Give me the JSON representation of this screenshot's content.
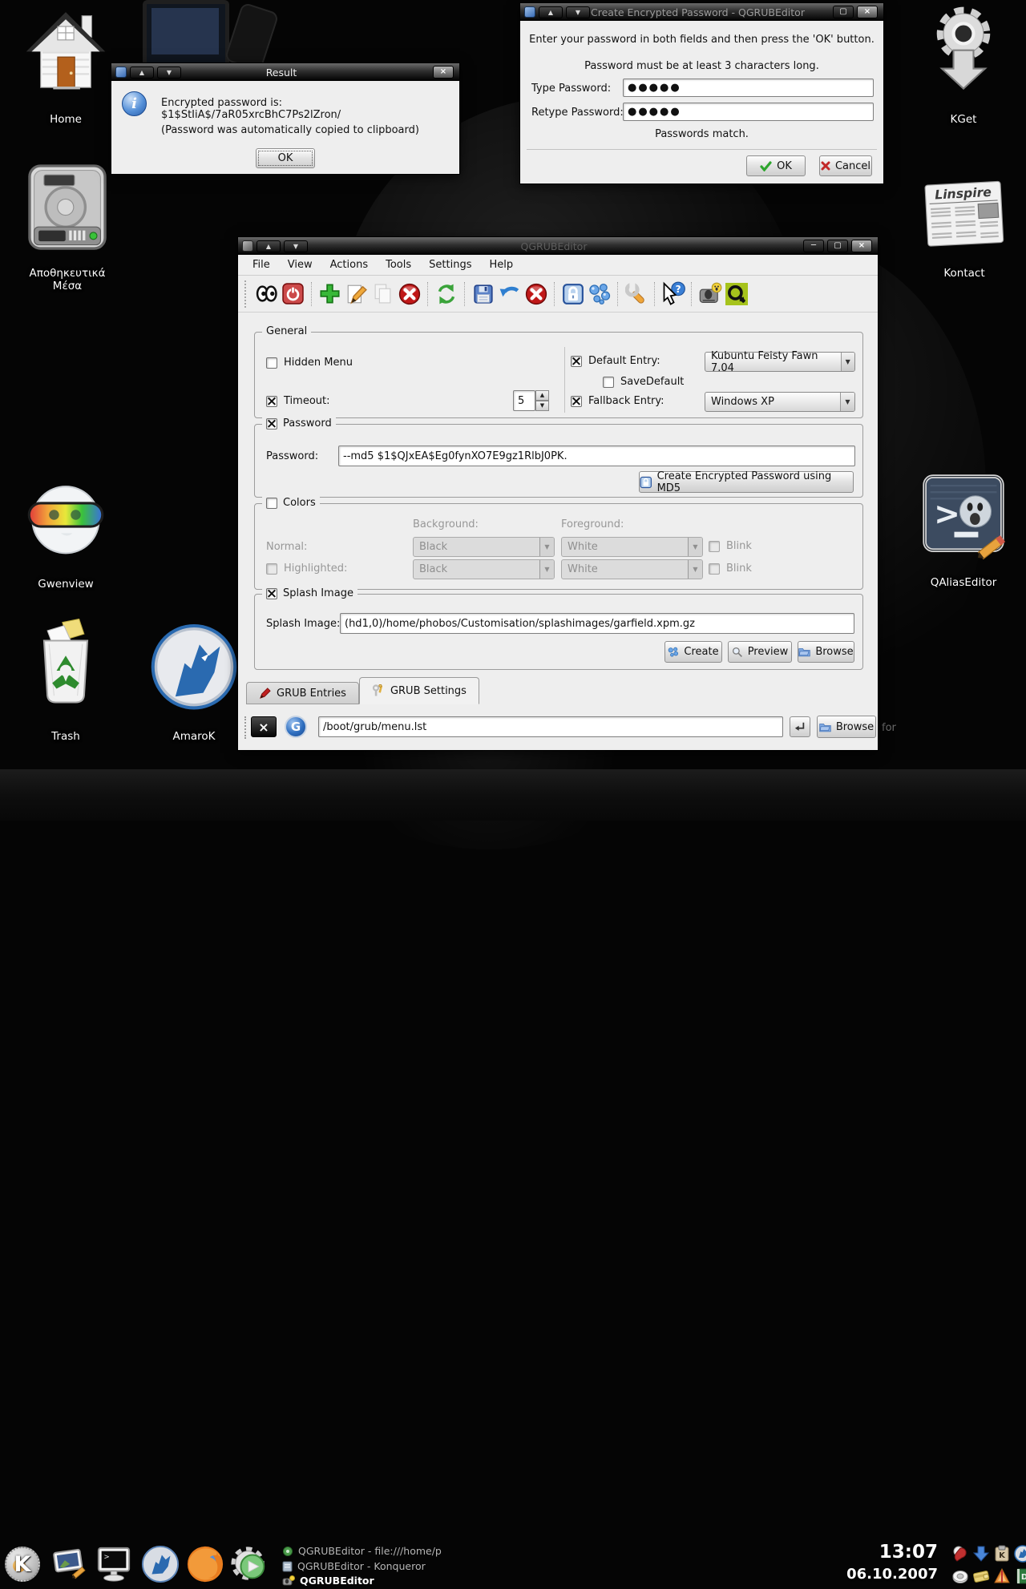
{
  "desktop": {
    "background_color": "#050505",
    "faint_text": "for",
    "icons": [
      {
        "label": "Home",
        "icon": "home-icon"
      },
      {
        "label": "KGet",
        "icon": "gear-download-icon"
      },
      {
        "label": "Αποθηκευτικά Μέσα",
        "icon": "hard-drive-icon"
      },
      {
        "label": "Kontact",
        "icon": "newspaper-icon"
      },
      {
        "label": "Gwenview",
        "icon": "rainbow-goggles-icon"
      },
      {
        "label": "QAliasEditor",
        "icon": "terminal-smiley-icon"
      },
      {
        "label": "Trash",
        "icon": "trash-can-icon"
      },
      {
        "label": "AmaroK",
        "icon": "blue-wolf-icon"
      }
    ]
  },
  "result_dialog": {
    "title": "Result",
    "icon": "info-icon",
    "message_line1": "Encrypted password is: $1$StIiA$/7aR05xrcBhC7Ps2lZron/",
    "message_line2": "(Password was automatically copied to clipboard)",
    "ok_label": "OK"
  },
  "password_dialog": {
    "title": "Create Encrypted Password - QGRUBEditor",
    "instruction": "Enter your password in both fields and then press the 'OK' button.",
    "requirement": "Password must be at least 3 characters long.",
    "type_password_label": "Type Password:",
    "retype_password_label": "Retype Password:",
    "password_value": "●●●●●",
    "retype_value": "●●●●●",
    "status": "Passwords match.",
    "ok_label": "OK",
    "cancel_label": "Cancel"
  },
  "main_window": {
    "title": "QGRUBEditor",
    "menu_items": [
      "File",
      "View",
      "Actions",
      "Tools",
      "Settings",
      "Help"
    ],
    "toolbar_icons": [
      "eyes",
      "shutdown",
      "add-entry",
      "edit-entry",
      "copy-entry",
      "delete-entry",
      "refresh",
      "save",
      "revert",
      "discard",
      "create-encrypted-password",
      "create-splash-image",
      "configure-wrench",
      "whats-this",
      "device-alias",
      "qgrubeditor-logo"
    ],
    "general": {
      "legend": "General",
      "hidden_menu_label": "Hidden Menu",
      "timeout_label": "Timeout:",
      "timeout_value": "5",
      "default_entry_label": "Default Entry:",
      "default_entry_value": "Kubuntu Feisty Fawn 7.04",
      "savedefault_label": "SaveDefault",
      "fallback_entry_label": "Fallback Entry:",
      "fallback_entry_value": "Windows XP"
    },
    "password": {
      "legend": "Password",
      "password_label": "Password:",
      "password_value": "--md5 $1$QJxEA$Eg0fynXO7E9gz1RlbJ0PK.",
      "create_button_label": "Create Encrypted Password using MD5"
    },
    "colors": {
      "legend": "Colors",
      "background_header": "Background:",
      "foreground_header": "Foreground:",
      "normal_label": "Normal:",
      "highlighted_label": "Highlighted:",
      "normal_background": "Black",
      "normal_foreground": "White",
      "highlighted_background": "Black",
      "highlighted_foreground": "White",
      "blink_label_1": "Blink",
      "blink_label_2": "Blink"
    },
    "splash": {
      "legend": "Splash Image",
      "label": "Splash Image:",
      "value": "(hd1,0)/home/phobos/Customisation/splashimages/garfield.xpm.gz",
      "create_label": "Create",
      "preview_label": "Preview",
      "browse_label": "Browse"
    },
    "tabs": [
      {
        "label": "GRUB Entries",
        "icon": "red-pencil-icon"
      },
      {
        "label": "GRUB Settings",
        "icon": "tools-icon"
      }
    ],
    "file_bar": {
      "path": "/boot/grub/menu.lst",
      "browse_label": "Browse"
    }
  },
  "taskbar": {
    "launchers": [
      "kmenu",
      "desktop-edit",
      "konsole",
      "linspire-wolf",
      "firefox",
      "system-globe"
    ],
    "tasks": [
      {
        "label": "QGRUBEditor - file:///home/p",
        "icon": "green-gear-icon",
        "active": false
      },
      {
        "label": "QGRUBEditor - Konqueror",
        "icon": "document-icon",
        "active": false
      },
      {
        "label": "QGRUBEditor",
        "icon": "drive-smiley-icon",
        "active": true
      }
    ],
    "clock_time": "13:07",
    "clock_date": "06.10.2007",
    "tray_icons": [
      "kopete",
      "kget",
      "klipper",
      "amarok",
      "kmix",
      "kwallet",
      "alarm",
      "dictionary-d"
    ]
  }
}
